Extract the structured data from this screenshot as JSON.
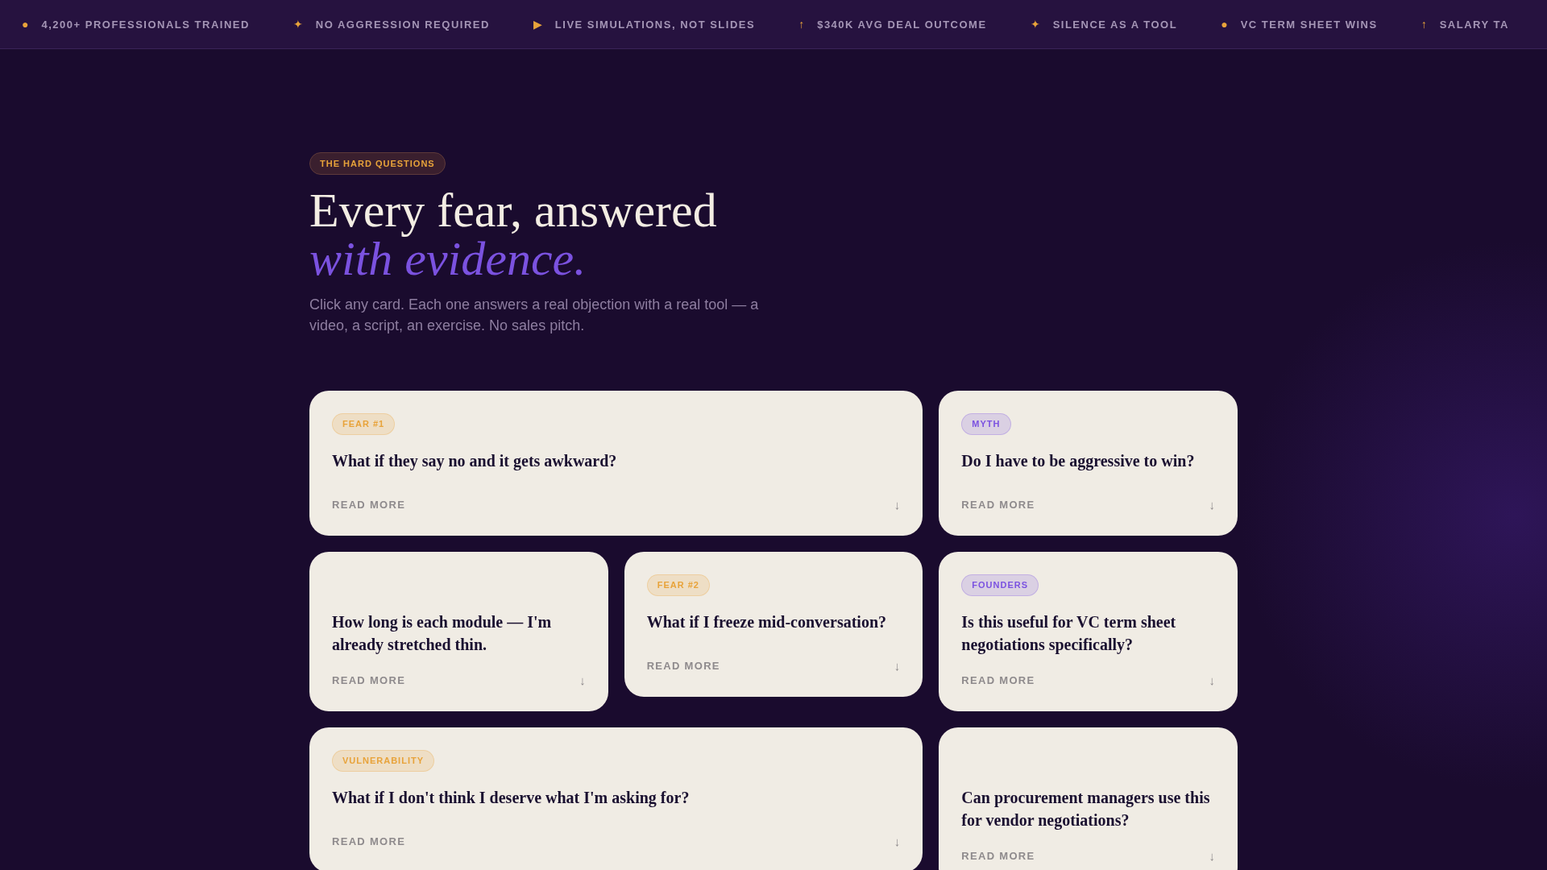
{
  "ticker": [
    {
      "icon": "●",
      "label": "4,200+ PROFESSIONALS TRAINED"
    },
    {
      "icon": "✦",
      "label": "NO AGGRESSION REQUIRED"
    },
    {
      "icon": "▶",
      "label": "LIVE SIMULATIONS, NOT SLIDES"
    },
    {
      "icon": "↑",
      "label": "$340K AVG DEAL OUTCOME"
    },
    {
      "icon": "✦",
      "label": "SILENCE AS A TOOL"
    },
    {
      "icon": "●",
      "label": "VC TERM SHEET WINS"
    },
    {
      "icon": "↑",
      "label": "SALARY TA"
    }
  ],
  "hero": {
    "eyebrow": "THE HARD QUESTIONS",
    "title": "Every fear, answered",
    "title_accent": "with evidence.",
    "subtitle": "Click any card. Each one answers a real objection with a real tool — a video, a script, an exercise. No sales pitch."
  },
  "cards": [
    {
      "tag": "FEAR #1",
      "color": "#e8a33a",
      "question": "What if they say no and it gets awkward?",
      "link": "READ MORE",
      "arrow": "↓",
      "wide": true
    },
    {
      "tag": "MYTH",
      "color": "#7b52e0",
      "question": "Do I have to be aggressive to win?",
      "link": "READ MORE",
      "arrow": "↓",
      "wide": false
    },
    {
      "question": "How long is each module — I'm already stretched thin.",
      "link": "READ MORE",
      "arrow": "↓",
      "wide": false
    },
    {
      "tag": "FEAR #2",
      "color": "#e8a33a",
      "question": "What if I freeze mid-conversation?",
      "link": "READ MORE",
      "arrow": "↓",
      "wide": false
    },
    {
      "tag": "FOUNDERS",
      "color": "#7b52e0",
      "question": "Is this useful for VC term sheet negotiations specifically?",
      "link": "READ MORE",
      "arrow": "↓",
      "wide": false
    },
    {
      "tag": "VULNERABILITY",
      "color": "#e8a33a",
      "question": "What if I don't think I deserve what I'm asking for?",
      "link": "READ MORE",
      "arrow": "↓",
      "wide": true
    },
    {
      "question": "Can procurement managers use this for vendor negotiations?",
      "link": "READ MORE",
      "arrow": "↓",
      "wide": false
    }
  ]
}
